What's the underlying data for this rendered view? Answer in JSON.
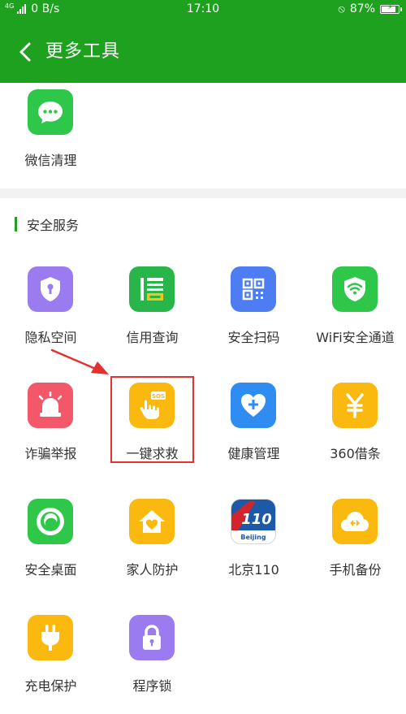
{
  "status_bar": {
    "network_tag": "4G",
    "speed": "0 B/s",
    "time": "17:10",
    "battery_percent": "87%",
    "battery_level": 0.87
  },
  "app_bar": {
    "title": "更多工具"
  },
  "top_tools": [
    {
      "label": "微信清理",
      "icon": "wechat-chat-icon",
      "color": "#2ec74a"
    }
  ],
  "section": {
    "title": "安全服务",
    "accent_color": "#1ea11e"
  },
  "tools": [
    {
      "label": "隐私空间",
      "icon": "shield-lock-icon",
      "color": "#9b7cf0"
    },
    {
      "label": "信用查询",
      "icon": "credit-xin-icon",
      "color": "#28b54a"
    },
    {
      "label": "安全扫码",
      "icon": "qr-scan-icon",
      "color": "#4d7cf3"
    },
    {
      "label": "WiFi安全通道",
      "icon": "wifi-shield-icon",
      "color": "#2ec74a"
    },
    {
      "label": "诈骗举报",
      "icon": "alarm-siren-icon",
      "color": "#f2586a"
    },
    {
      "label": "一键求救",
      "icon": "sos-hand-icon",
      "color": "#fbb80f"
    },
    {
      "label": "健康管理",
      "icon": "heart-plus-icon",
      "color": "#2f8cf0"
    },
    {
      "label": "360借条",
      "icon": "yuan-icon",
      "color": "#fbb80f"
    },
    {
      "label": "安全桌面",
      "icon": "desktop-swirl-icon",
      "color": "#2ec74a"
    },
    {
      "label": "家人防护",
      "icon": "home-heart-icon",
      "color": "#fbb80f"
    },
    {
      "label": "北京110",
      "icon": "beijing-110-icon",
      "color": "#1c5aa8",
      "badge": "Beijing"
    },
    {
      "label": "手机备份",
      "icon": "cloud-sync-icon",
      "color": "#fbb80f"
    },
    {
      "label": "充电保护",
      "icon": "plug-icon",
      "color": "#fbb80f"
    },
    {
      "label": "程序锁",
      "icon": "padlock-icon",
      "color": "#9b7cf0"
    }
  ],
  "annotation": {
    "highlight_color": "#e53030"
  }
}
